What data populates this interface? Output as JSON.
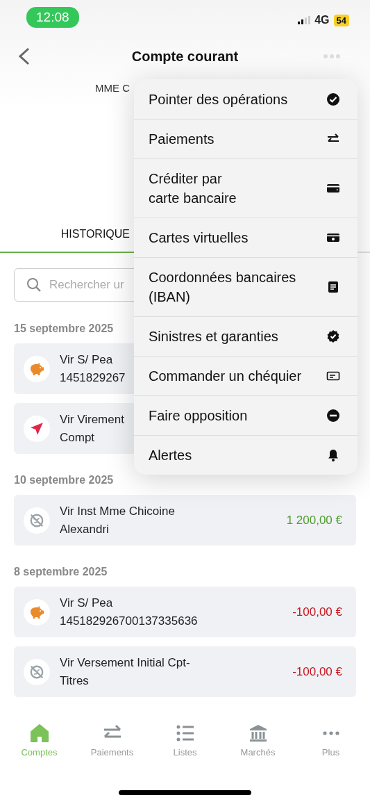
{
  "status_bar": {
    "time": "12:08",
    "network": "4G",
    "battery": "54"
  },
  "header": {
    "title": "Compte courant"
  },
  "account": {
    "holder": "MME C"
  },
  "tabs": [
    {
      "label": "HISTORIQUE",
      "selected": true
    }
  ],
  "search": {
    "placeholder": "Rechercher ur"
  },
  "groups": [
    {
      "date": "15 septembre 2025",
      "transactions": [
        {
          "kind": "savings",
          "lines": [
            "Vir S/ Pea",
            "1451829267"
          ]
        },
        {
          "kind": "transfer",
          "lines": [
            "Vir Virement",
            "Compt"
          ]
        }
      ]
    },
    {
      "date": "10 septembre 2025",
      "transactions": [
        {
          "kind": "uncategorized",
          "lines": [
            "Vir Inst Mme Chicoine",
            "Alexandri"
          ],
          "amount": "1 200,00 €",
          "color": "#4f9d2d"
        }
      ]
    },
    {
      "date": "8 septembre 2025",
      "transactions": [
        {
          "kind": "savings",
          "lines": [
            "Vir S/ Pea",
            "145182926700137335636"
          ],
          "amount": "-100,00 €",
          "color": "#c9161d"
        },
        {
          "kind": "uncategorized",
          "lines": [
            "Vir Versement Initial Cpt-",
            "Titres"
          ],
          "amount": "-100,00 €",
          "color": "#c9161d"
        }
      ]
    }
  ],
  "menu": [
    {
      "label": "Pointer des opérations",
      "kind": "check"
    },
    {
      "label": "Paiements",
      "kind": "transfer"
    },
    {
      "label": "Créditer par\ncarte bancaire",
      "kind": "card"
    },
    {
      "label": "Cartes virtuelles",
      "kind": "virtual-card"
    },
    {
      "label": "Coordonnées bancaires\n(IBAN)",
      "kind": "document"
    },
    {
      "label": "Sinistres et garanties",
      "kind": "badge"
    },
    {
      "label": "Commander un chéquier",
      "kind": "chequebook"
    },
    {
      "label": "Faire opposition",
      "kind": "block"
    },
    {
      "label": "Alertes",
      "kind": "bell"
    }
  ],
  "nav": [
    {
      "label": "Comptes",
      "kind": "home",
      "selected": true
    },
    {
      "label": "Paiements",
      "kind": "transfer",
      "selected": false
    },
    {
      "label": "Listes",
      "kind": "list",
      "selected": false
    },
    {
      "label": "Marchés",
      "kind": "bank",
      "selected": false
    },
    {
      "label": "Plus",
      "kind": "more",
      "selected": false
    }
  ]
}
